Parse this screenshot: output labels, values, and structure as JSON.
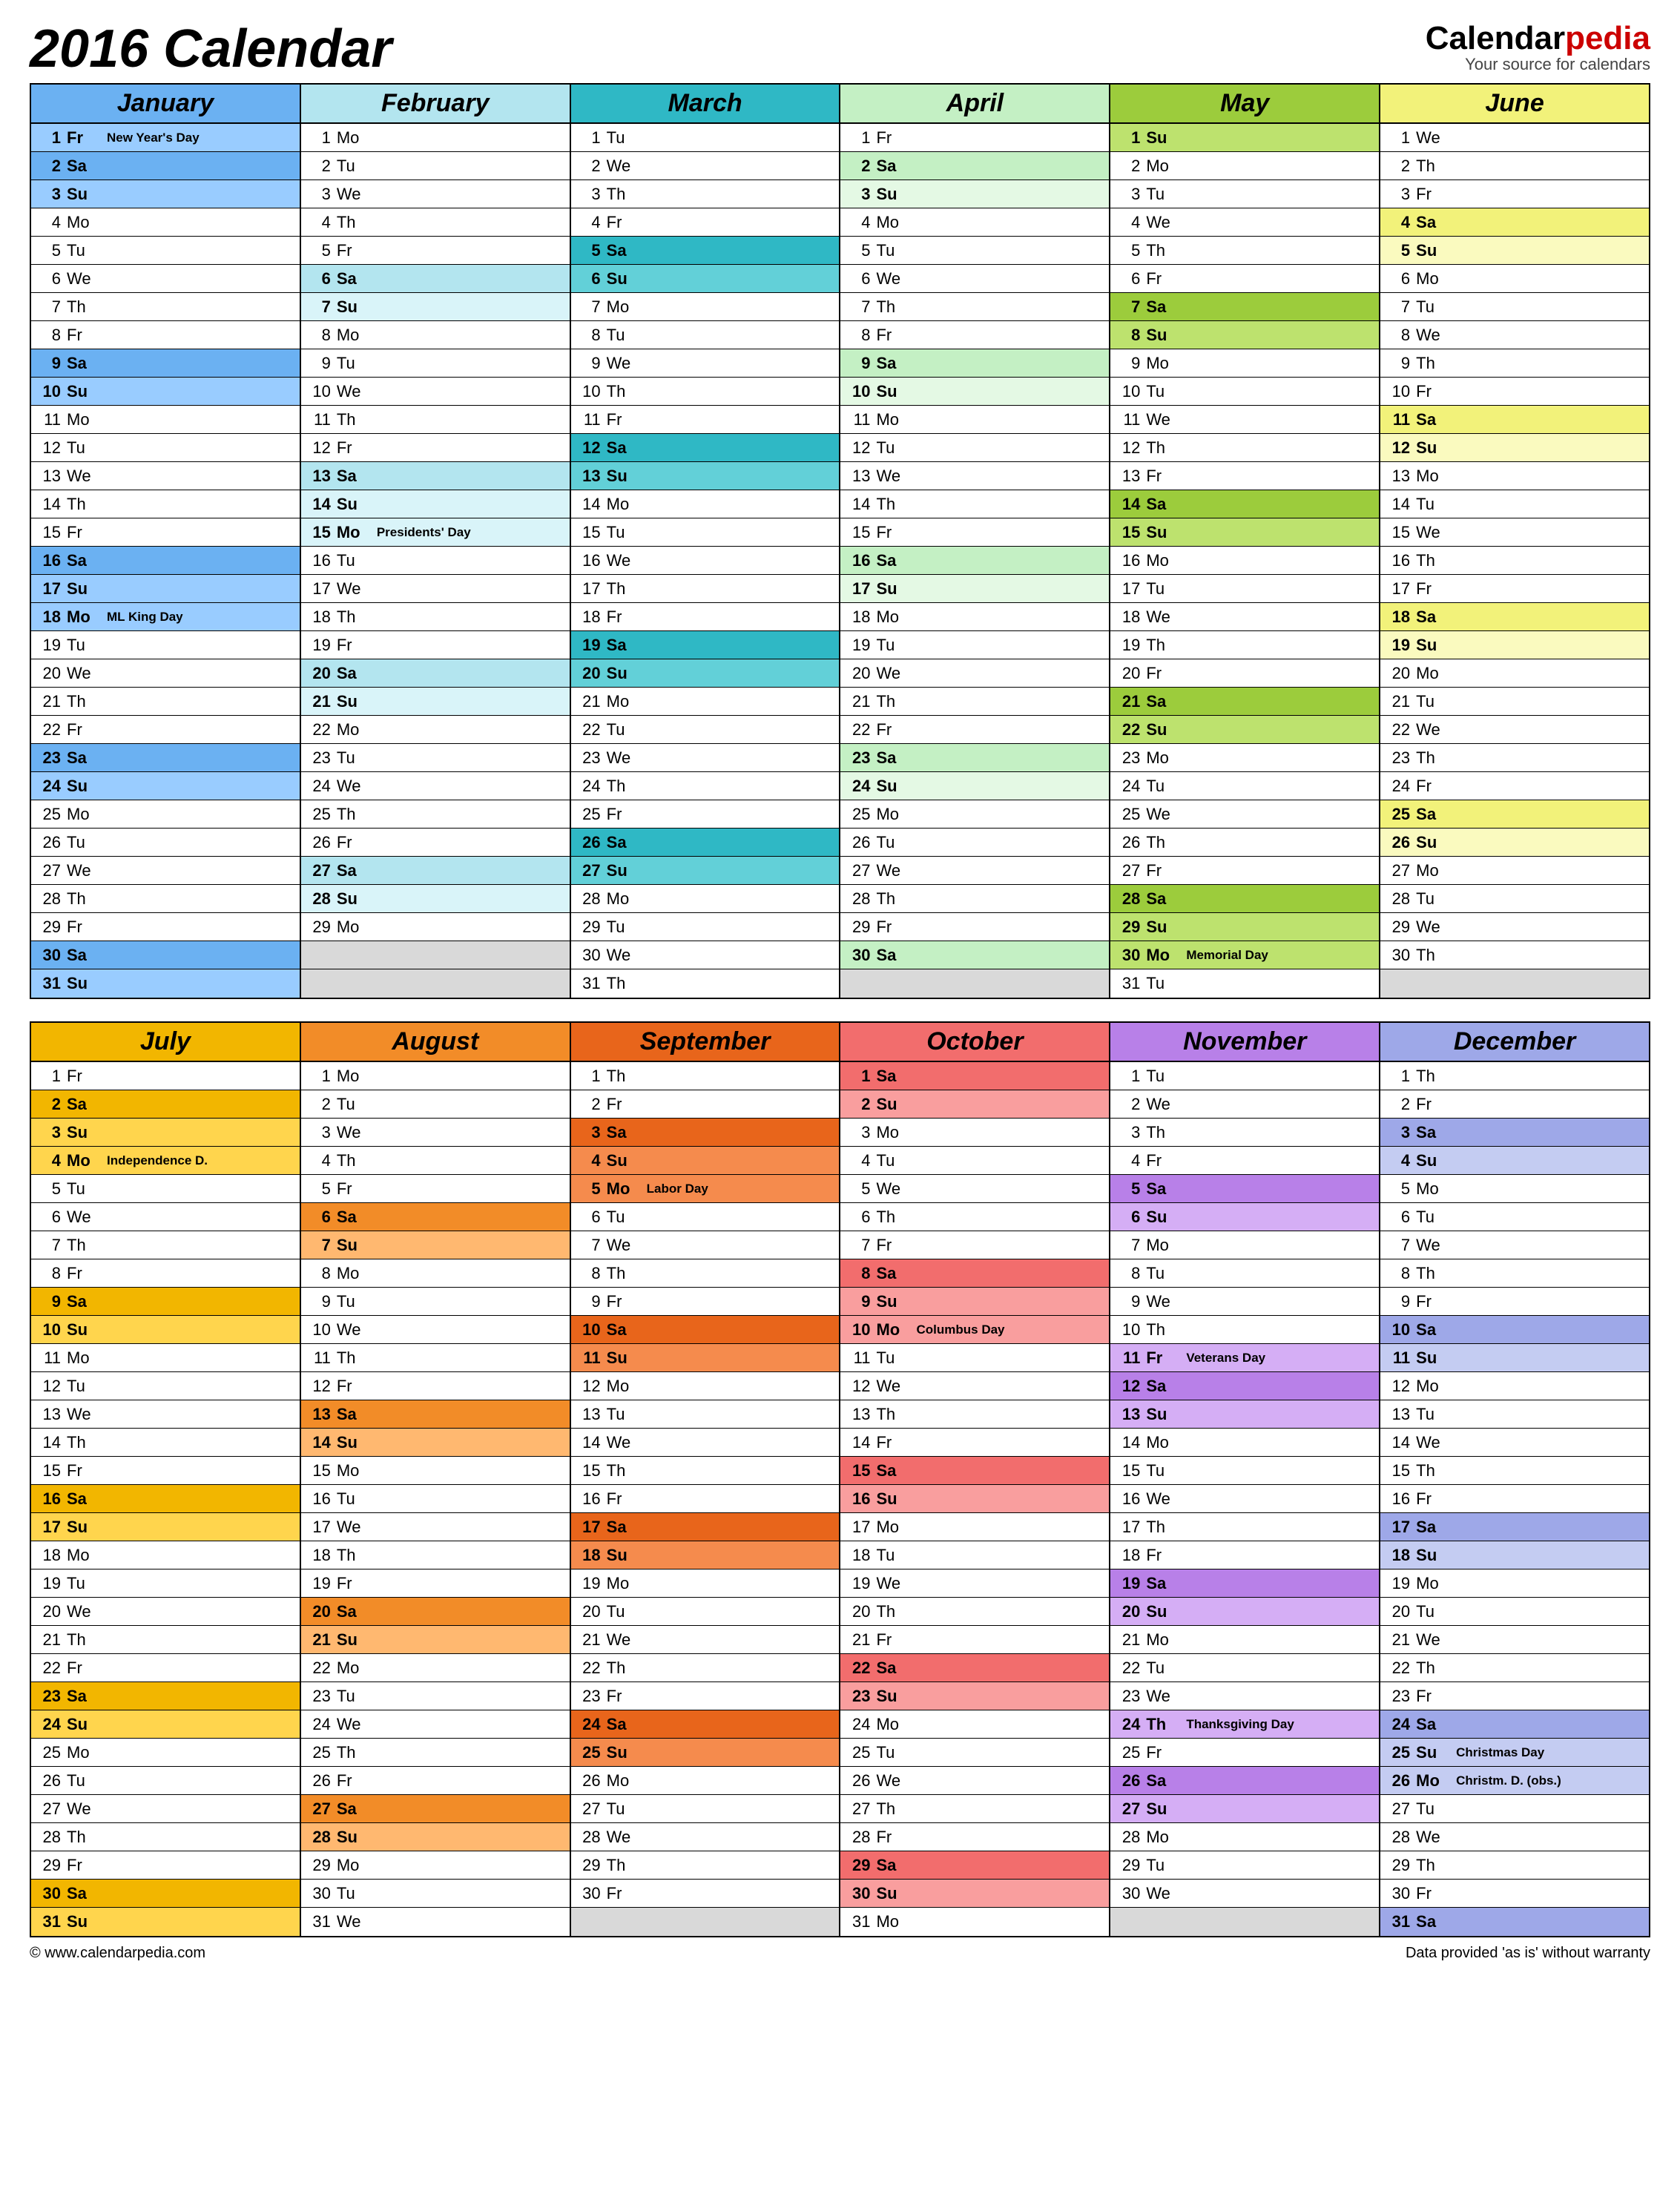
{
  "title": "2016 Calendar",
  "brand": {
    "main1": "Calendar",
    "main2": "pedia",
    "sub": "Your source for calendars"
  },
  "footer": {
    "left": "© www.calendarpedia.com",
    "right": "Data provided 'as is' without warranty"
  },
  "dow": [
    "Su",
    "Mo",
    "Tu",
    "We",
    "Th",
    "Fr",
    "Sa"
  ],
  "colors": {
    "jan": {
      "head": "#6bb1f2",
      "sat": "#6bb1f2",
      "sun": "#99ccff",
      "hol": "#99ccff"
    },
    "feb": {
      "head": "#b3e5ef",
      "sat": "#b3e5ef",
      "sun": "#d9f4f9",
      "hol": "#d9f4f9"
    },
    "mar": {
      "head": "#2fb8c5",
      "sat": "#2fb8c5",
      "sun": "#62d0d8",
      "hol": "#62d0d8"
    },
    "apr": {
      "head": "#c4f0c4",
      "sat": "#c4f0c4",
      "sun": "#e4f9e4",
      "hol": "#e4f9e4"
    },
    "may": {
      "head": "#9ccc3c",
      "sat": "#9ccc3c",
      "sun": "#bde26e",
      "hol": "#bde26e"
    },
    "jun": {
      "head": "#f2f27a",
      "sat": "#f2f27a",
      "sun": "#fafabf",
      "hol": "#fafabf"
    },
    "jul": {
      "head": "#f2b600",
      "sat": "#f2b600",
      "sun": "#ffd54d",
      "hol": "#ffd54d"
    },
    "aug": {
      "head": "#f28c28",
      "sat": "#f28c28",
      "sun": "#ffb870",
      "hol": "#ffb870"
    },
    "sep": {
      "head": "#e8651b",
      "sat": "#e8651b",
      "sun": "#f58b4d",
      "hol": "#f58b4d"
    },
    "oct": {
      "head": "#f26d6d",
      "sat": "#f26d6d",
      "sun": "#f99e9e",
      "hol": "#f99e9e"
    },
    "nov": {
      "head": "#b880e8",
      "sat": "#b880e8",
      "sun": "#d5aef5",
      "hol": "#d5aef5"
    },
    "dec": {
      "head": "#9ea8e8",
      "sat": "#9ea8e8",
      "sun": "#c4ccf2",
      "hol": "#c4ccf2"
    }
  },
  "months": [
    {
      "key": "jan",
      "name": "January",
      "days": 31,
      "start": 5,
      "holidays": {
        "1": "New Year's Day",
        "18": "ML King Day"
      }
    },
    {
      "key": "feb",
      "name": "February",
      "days": 29,
      "start": 1,
      "holidays": {
        "15": "Presidents' Day"
      }
    },
    {
      "key": "mar",
      "name": "March",
      "days": 31,
      "start": 2,
      "holidays": {}
    },
    {
      "key": "apr",
      "name": "April",
      "days": 30,
      "start": 5,
      "holidays": {}
    },
    {
      "key": "may",
      "name": "May",
      "days": 31,
      "start": 0,
      "holidays": {
        "30": "Memorial Day"
      }
    },
    {
      "key": "jun",
      "name": "June",
      "days": 30,
      "start": 3,
      "holidays": {}
    },
    {
      "key": "jul",
      "name": "July",
      "days": 31,
      "start": 5,
      "holidays": {
        "4": "Independence D."
      }
    },
    {
      "key": "aug",
      "name": "August",
      "days": 31,
      "start": 1,
      "holidays": {}
    },
    {
      "key": "sep",
      "name": "September",
      "days": 30,
      "start": 4,
      "holidays": {
        "5": "Labor Day"
      }
    },
    {
      "key": "oct",
      "name": "October",
      "days": 31,
      "start": 6,
      "holidays": {
        "10": "Columbus Day"
      }
    },
    {
      "key": "nov",
      "name": "November",
      "days": 30,
      "start": 2,
      "holidays": {
        "11": "Veterans Day",
        "24": "Thanksgiving Day"
      }
    },
    {
      "key": "dec",
      "name": "December",
      "days": 31,
      "start": 4,
      "holidays": {
        "25": "Christmas Day",
        "26": "Christm. D. (obs.)"
      }
    }
  ]
}
